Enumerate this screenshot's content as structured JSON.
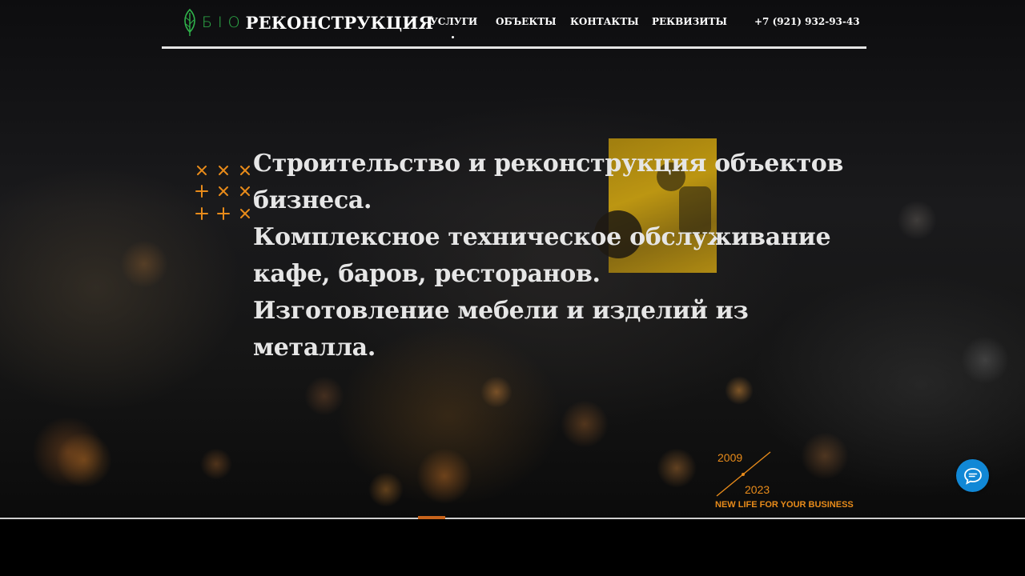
{
  "header": {
    "logo": {
      "prefix": "БIO",
      "main": "РЕКОНСТРУКЦИЯ"
    },
    "nav": [
      {
        "label": "УСЛУГИ"
      },
      {
        "label": "ОБЪЕКТЫ"
      },
      {
        "label": "КОНТАКТЫ"
      },
      {
        "label": "РЕКВИЗИТЫ"
      }
    ],
    "phone": "+7 (921) 932-93-43"
  },
  "hero": {
    "headline": [
      "Строительство и реконструкция объектов",
      "бизнеса.",
      "Комплексное техническое обслуживание",
      "кафе, баров, ресторанов.",
      "Изготовление мебели и изделий из",
      "металла."
    ]
  },
  "badge": {
    "year_start": "2009",
    "year_end": "2023",
    "tagline": "NEW LIFE FOR YOUR BUSINESS"
  },
  "colors": {
    "brand_green": "#2fb24a",
    "accent_orange": "#e88b1a",
    "chat_blue": "#1188d6"
  },
  "icons": {
    "logo": "leaf-icon",
    "chat": "chat-bubble-icon",
    "decor": "crosses-pattern-icon"
  }
}
